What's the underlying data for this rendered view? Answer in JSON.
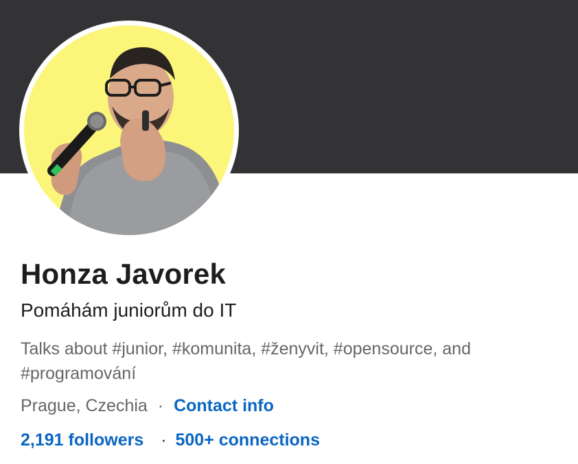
{
  "profile": {
    "name": "Honza Javorek",
    "headline": "Pomáhám juniorům do IT",
    "talks_about": "Talks about #junior, #komunita, #ženyvit, #opensource, and #programování",
    "location": "Prague, Czechia",
    "separator": "·",
    "contact_info_label": "Contact info",
    "followers_label": "2,191 followers",
    "connections_label": "500+ connections"
  },
  "colors": {
    "cover": "#333336",
    "avatar_background": "#fbf57a",
    "link": "#0a66c2",
    "text_primary": "#1d1d1d",
    "text_secondary": "#666666"
  },
  "icons": {
    "avatar": "profile-photo"
  }
}
